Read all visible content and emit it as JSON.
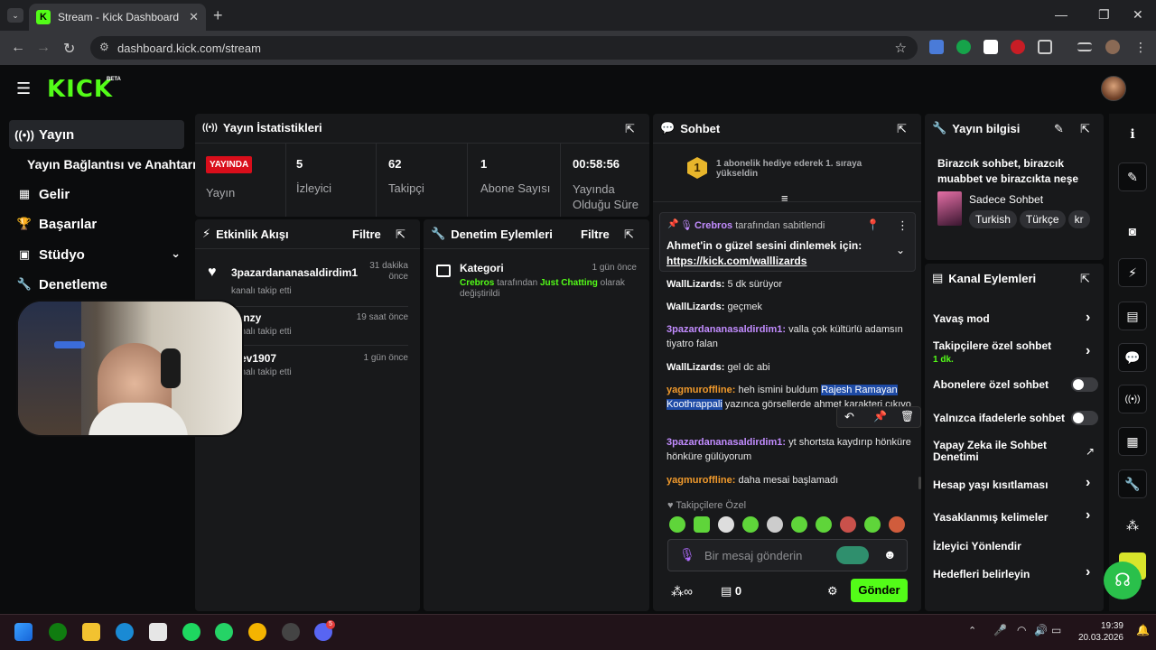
{
  "browser": {
    "tab_title": "Stream - Kick Dashboard",
    "url": "dashboard.kick.com/stream",
    "favicon_letter": "K"
  },
  "app": {
    "logo": "KICK",
    "beta": "BETA"
  },
  "sidebar": {
    "items": [
      {
        "icon": "broadcast-icon",
        "label": "Yayın"
      },
      {
        "icon": "",
        "label": "Yayın Bağlantısı ve Anahtarı"
      },
      {
        "icon": "dollar-icon",
        "label": "Gelir"
      },
      {
        "icon": "trophy-icon",
        "label": "Başarılar"
      },
      {
        "icon": "studio-icon",
        "label": "Stüdyo"
      },
      {
        "icon": "wrench-icon",
        "label": "Denetleme"
      }
    ]
  },
  "stats": {
    "title": "Yayın İstatistikleri",
    "live_badge": "YAYINDA",
    "stream_label": "Yayın",
    "items": [
      {
        "value": "5",
        "label": "İzleyici"
      },
      {
        "value": "62",
        "label": "Takipçi"
      },
      {
        "value": "1",
        "label": "Abone Sayısı"
      },
      {
        "value": "00:58:56",
        "label": "Yayında Olduğu Süre"
      }
    ]
  },
  "activity": {
    "title": "Etkinlik Akışı",
    "filter": "Filtre",
    "items": [
      {
        "user": "3pazardananasaldirdim1",
        "action": "kanalı takip etti",
        "time": "31 dakika önce"
      },
      {
        "user": "lienzy",
        "action": "kanalı takip etti",
        "time": "19 saat önce"
      },
      {
        "user": "iyev1907",
        "action": "kanalı takip etti",
        "time": "1 gün önce"
      }
    ]
  },
  "moderation": {
    "title": "Denetim Eylemleri",
    "filter": "Filtre",
    "items": [
      {
        "title": "Kategori",
        "time": "1 gün önce",
        "actor": "Crebros",
        "mid": "tarafından",
        "target": "Just Chatting",
        "rest": "olarak değiştirildi"
      }
    ]
  },
  "chat": {
    "title": "Sohbet",
    "gift_rank": "1",
    "gift_text": "1 abonelik hediye ederek 1. sıraya yükseldin",
    "pinned": {
      "by_user": "Crebros",
      "by_text": "tarafından sabitlendi",
      "message": "Ahmet'in o güzel sesini dinlemek için:",
      "link": "https://kick.com/walllizards"
    },
    "messages": [
      {
        "user": "WallLizards",
        "text": "5 dk sürüyor"
      },
      {
        "user": "WallLizards",
        "text": "geçmek"
      },
      {
        "user": "3pazardananasaldirdim1",
        "text": "valla çok kültürlü adamsın tiyatro falan"
      },
      {
        "user": "WallLizards",
        "text": "gel dc abi"
      },
      {
        "user": "yagmuroffline",
        "text_before": "heh ismini buldum ",
        "highlight": "Rajesh Ramayan Koothrappali",
        "text_after": " yazınca görsellerde ahmet karakteri çıkıyo"
      },
      {
        "user": "3pazardananasaldirdim1",
        "text": "yt shortsta kaydırıp hönküre hönküre gülüyorum"
      },
      {
        "user": "yagmuroffline",
        "text": "daha mesai başlamadı"
      }
    ],
    "followers_only": "Takipçilere Özel",
    "input_placeholder": "Bir mesaj gönderin",
    "send": "Gönder",
    "infinity": "∞",
    "shop_count": "0"
  },
  "stream_info": {
    "title": "Yayın bilgisi",
    "stream_title": "Birazcık sohbet, birazcık muabbet ve birazcıkta neşe",
    "category": "Sadece Sohbet",
    "tags": [
      "Turkish",
      "Türkçe",
      "kr"
    ]
  },
  "channel_actions": {
    "title": "Kanal Eylemleri",
    "slow_mode": "Yavaş mod",
    "followers_chat": "Takipçilere özel sohbet",
    "followers_chat_value": "1 dk.",
    "subs_chat": "Abonelere özel sohbet",
    "emote_only": "Yalnızca ifadelerle sohbet",
    "ai_mod": "Yapay Zeka ile Sohbet Denetimi",
    "age_restriction": "Hesap yaşı kısıtlaması",
    "banned_words": "Yasaklanmış kelimeler",
    "raid": "İzleyici Yönlendir",
    "goals": "Hedefleri belirleyin"
  },
  "taskbar": {
    "time": "19:39",
    "date": "20.03.2026",
    "discord_badge": "5"
  },
  "colors": {
    "brand": "#53fc18",
    "live": "#d90e1b",
    "panel": "#18191b"
  }
}
